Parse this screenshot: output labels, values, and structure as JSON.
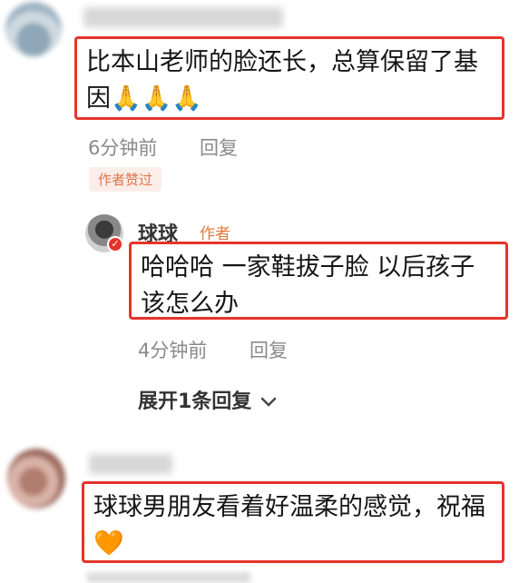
{
  "comments": [
    {
      "text": "比本山老师的脸还长，总算保留了基因🙏🙏🙏",
      "time": "6分钟前",
      "reply_label": "回复",
      "liked_badge": "作者赞过"
    },
    {
      "text": "球球男朋友看着好温柔的感觉，祝福🧡"
    }
  ],
  "reply": {
    "username": "球球",
    "author_badge": "作者",
    "text": "哈哈哈 一家鞋拔子脸 以后孩子该怎么办",
    "time": "4分钟前",
    "reply_label": "回复"
  },
  "expand_replies": "展开1条回复"
}
